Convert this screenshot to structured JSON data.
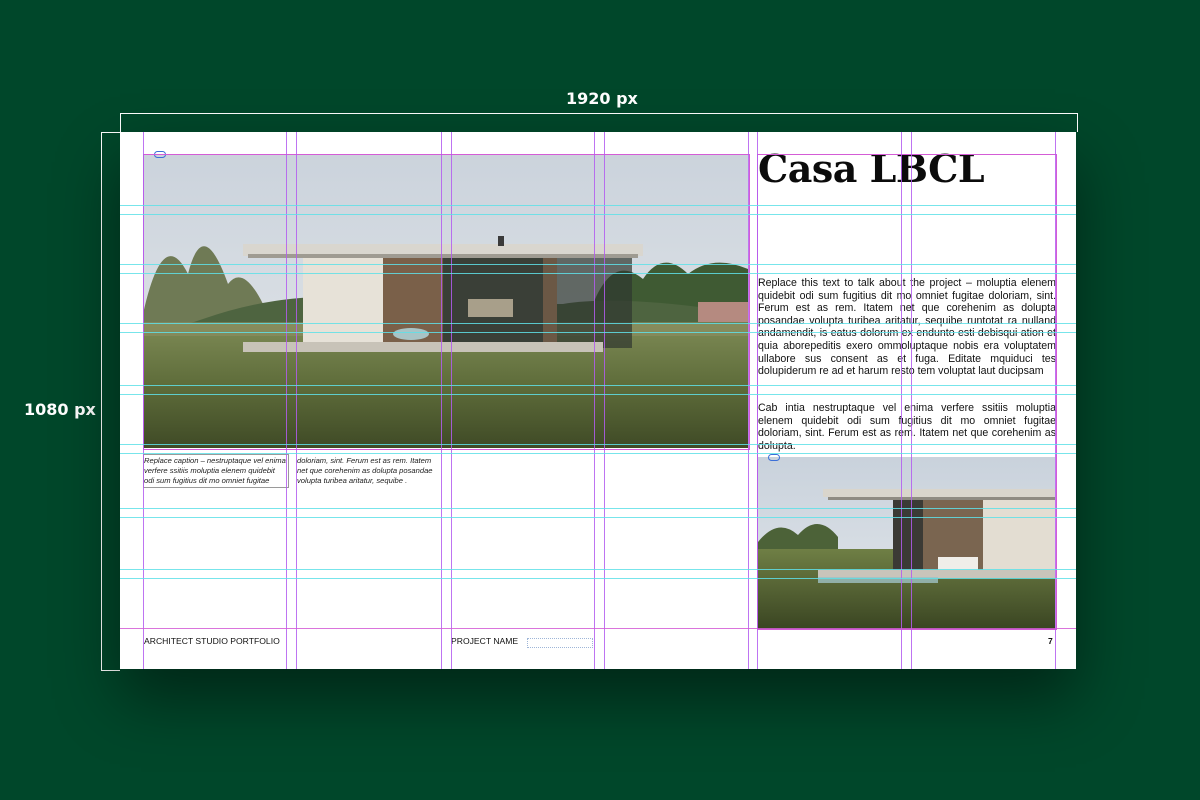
{
  "dimensions": {
    "width_label": "1920 px",
    "height_label": "1080 px"
  },
  "spread": {
    "title": "Casa LBCL",
    "body_paragraphs": [
      "Replace this text to talk about the project – moluptia elenem quidebit odi sum fugitius dit mo omniet fugitae doloriam, sint. Ferum est as rem. Itatem net que corehenim as dolupta posandae volupta turibea aritatur, sequibe runtotat ra nulland andamendit, is eatus dolorum ex endunto esti debisqui ation et quia aborepeditis exero ommoluptaque nobis era voluptatem ullabore sus consent as et fuga. Editate mquiduci tes dolupiderum re ad et harum resto tem voluptat laut ducipsam",
      "Cab intia nestruptaque vel enima verfere ssitiis moluptia elenem quidebit odi sum fugitius dit mo omniet fugitae doloriam, sint. Ferum est as rem. Itatem net que corehenim as dolupta."
    ],
    "captions": [
      "Replace caption – nestruptaque vel enima verfere ssitiis moluptia elenem quidebit odi sum fugitius dit mo omniet fugitae",
      "doloriam, sint. Ferum est as rem. Itatem net que corehenim as dolupta posandae volupta turibea aritatur, sequibe ."
    ],
    "footer": {
      "left": "ARCHITECT STUDIO PORTFOLIO",
      "center": "PROJECT NAME",
      "page_number": "7"
    }
  },
  "colors": {
    "background": "#00472a",
    "page": "#ffffff",
    "column_guides": "#b35cf0",
    "baseline_guides": "#5fe0e8",
    "frame_border": "#d45cd6",
    "link_badge": "#3b6fd8"
  },
  "icons": [
    "link-icon"
  ]
}
